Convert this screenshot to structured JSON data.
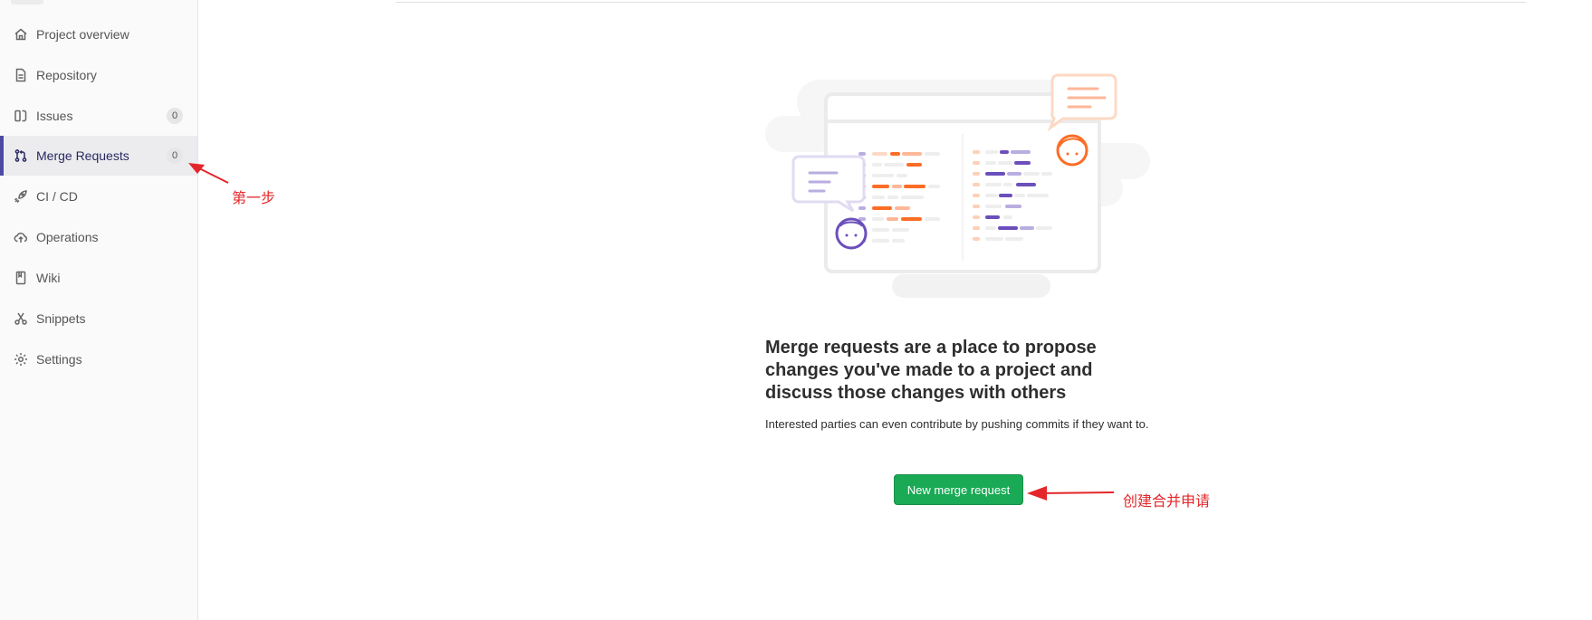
{
  "sidebar": {
    "items": [
      {
        "label": "Project overview",
        "icon": "home-icon"
      },
      {
        "label": "Repository",
        "icon": "document-icon"
      },
      {
        "label": "Issues",
        "icon": "issues-icon",
        "badge": "0"
      },
      {
        "label": "Merge Requests",
        "icon": "merge-request-icon",
        "badge": "0",
        "active": true
      },
      {
        "label": "CI / CD",
        "icon": "rocket-icon"
      },
      {
        "label": "Operations",
        "icon": "cloud-icon"
      },
      {
        "label": "Wiki",
        "icon": "book-icon"
      },
      {
        "label": "Snippets",
        "icon": "scissors-icon"
      },
      {
        "label": "Settings",
        "icon": "gear-icon"
      }
    ]
  },
  "empty_state": {
    "title": "Merge requests are a place to propose changes you've made to a project and discuss those changes with others",
    "description": "Interested parties can even contribute by pushing commits if they want to.",
    "button_label": "New merge request"
  },
  "annotations": {
    "step_one": "第一步",
    "create_merge": "创建合并申请"
  },
  "colors": {
    "active_bar": "#4b4ba3",
    "button_green": "#1aaa55",
    "annotation_red": "#e4262a",
    "illustration_orange": "#fc6d26",
    "illustration_purple": "#6b4fbb"
  }
}
